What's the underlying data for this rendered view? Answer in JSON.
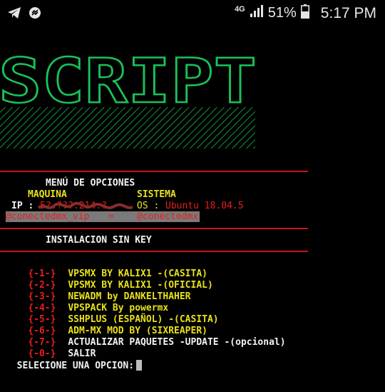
{
  "status": {
    "network": "4G",
    "battery_pct": "51%",
    "time": "5:17 PM"
  },
  "banner": {
    "text": "SCRIPT",
    "color": "#19c25a"
  },
  "colors": {
    "rule": "#c3151a",
    "yellow": "#e8e11a",
    "red": "#e81e1e",
    "white": "#f2f2f2"
  },
  "header": {
    "menu_title": "MENÚ DE OPCIONES",
    "maquina_label": "MAQUINA",
    "sistema_label": "SISTEMA",
    "ip_label": "IP :",
    "ip_value": "5?.???.214.?",
    "os_label": "OS :",
    "os_value": "Ubuntu 18.04.5",
    "credits_left": "@conectedmx_vip",
    "credits_sep": "=",
    "credits_right": "@conectedmx"
  },
  "section_title": "INSTALACION SIN KEY",
  "menu": [
    {
      "num": "{-1-}",
      "label": "VPSMX BY KALIX1 -(CASITA)"
    },
    {
      "num": "{-2-}",
      "label": "VPSMX BY KALIX1 -(OFICIAL)"
    },
    {
      "num": "{-3-}",
      "label": "NEWADM by DANKELTHAHER"
    },
    {
      "num": "{-4-}",
      "label": "VPSPACK By powermx"
    },
    {
      "num": "{-5-}",
      "label": "SSHPLUS (ESPAÑOL) -(CASITA)"
    },
    {
      "num": "{-6-}",
      "label": "ADM-MX MOD BY (SIXREAPER)"
    },
    {
      "num": "{-7-}",
      "label": "ACTUALIZAR PAQUETES -UPDATE -(opcional)"
    },
    {
      "num": "{-0-}",
      "label": "SALIR"
    }
  ],
  "prompt": "SELECIONE UNA OPCION:"
}
